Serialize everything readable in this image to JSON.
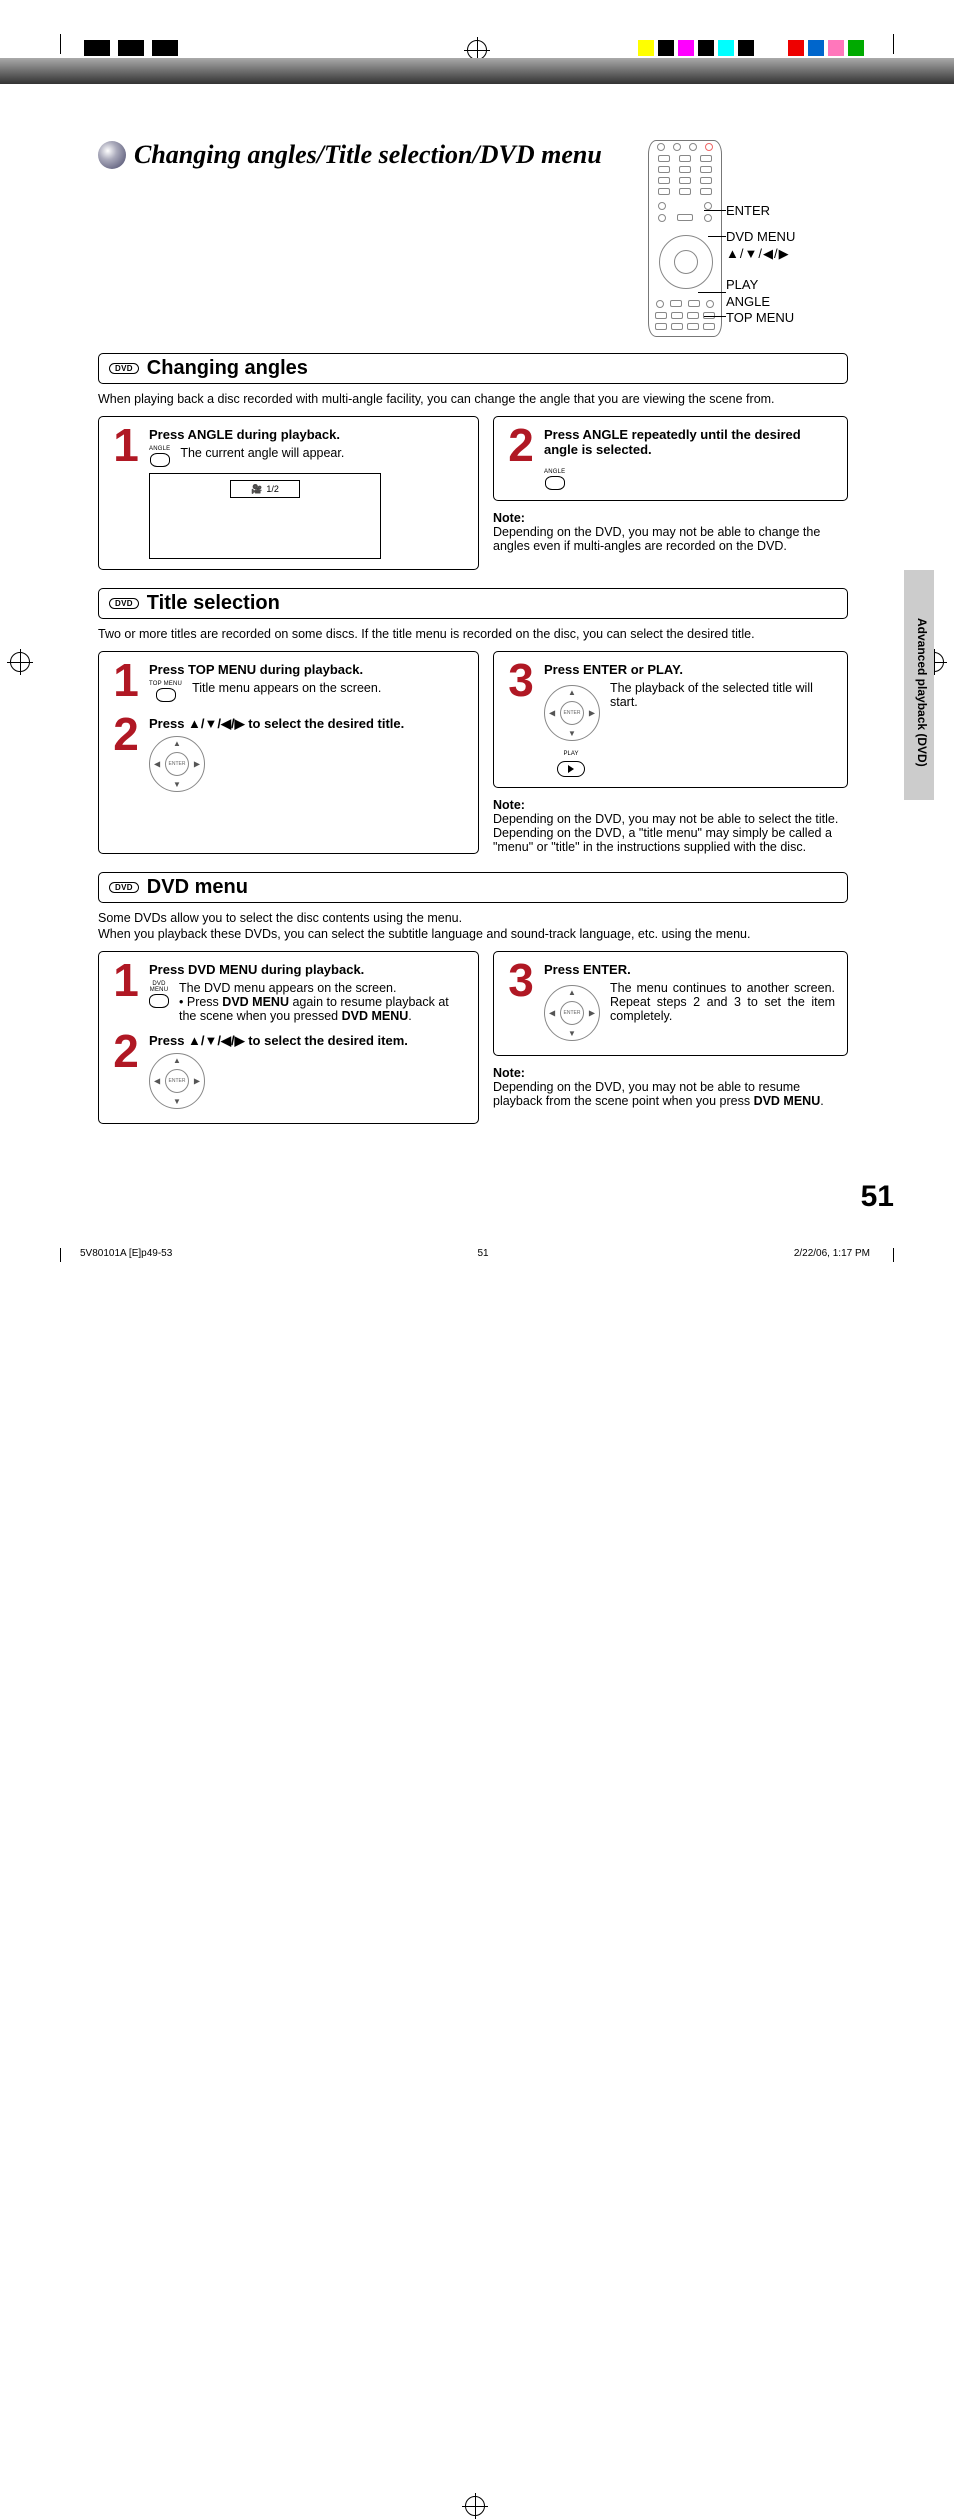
{
  "page_title": "Changing angles/Title selection/DVD menu",
  "remote_labels": {
    "enter": "ENTER",
    "dvdmenu": "DVD MENU",
    "arrows": "▲/▼/◀/▶",
    "play": "PLAY",
    "angle": "ANGLE",
    "topmenu": "TOP MENU"
  },
  "dvd_badge": "DVD",
  "sections": {
    "angles": {
      "title": "Changing angles",
      "intro": "When playing back a disc recorded with multi-angle facility, you can change the angle that you are viewing the scene from.",
      "step1": {
        "num": "1",
        "title": "Press ANGLE during playback.",
        "body": "The current angle will appear.",
        "btn": "ANGLE",
        "osd": "1/2"
      },
      "step2": {
        "num": "2",
        "title": "Press ANGLE repeatedly until the desired angle is selected.",
        "btn": "ANGLE"
      },
      "note_label": "Note:",
      "note": "Depending on the DVD, you may not be able to change the angles even if multi-angles are recorded on the DVD."
    },
    "title_sel": {
      "title": "Title selection",
      "intro": "Two or more titles are recorded on some discs. If the title menu is recorded on the disc, you can select the desired title.",
      "step1": {
        "num": "1",
        "title": "Press TOP MENU during playback.",
        "body": "Title menu appears on the screen.",
        "btn": "TOP MENU"
      },
      "step2": {
        "num": "2",
        "title": "Press ▲/▼/◀/▶ to select the desired title."
      },
      "step3": {
        "num": "3",
        "title": "Press ENTER or PLAY.",
        "body": "The playback of the selected title will start.",
        "play_label": "PLAY"
      },
      "note_label": "Note:",
      "note": "Depending on the DVD, you may not be able to select the title. Depending on the DVD, a \"title menu\" may simply be called a \"menu\" or \"title\" in the instructions supplied with the disc."
    },
    "dvd_menu": {
      "title": "DVD menu",
      "intro1": "Some DVDs allow you to select the disc contents using the menu.",
      "intro2": "When you playback these DVDs, you can select the subtitle language and sound-track language, etc. using the menu.",
      "step1": {
        "num": "1",
        "title": "Press DVD MENU during playback.",
        "body_a": "The DVD menu appears on the screen.",
        "body_b_pre": "Press ",
        "body_b_bold": "DVD MENU",
        "body_b_mid": " again to resume playback at the scene when you pressed ",
        "body_b_bold2": "DVD MENU",
        "body_b_end": ".",
        "btn": "DVD MENU"
      },
      "step2": {
        "num": "2",
        "title": "Press ▲/▼/◀/▶ to select the desired item."
      },
      "step3": {
        "num": "3",
        "title": "Press ENTER.",
        "body": "The menu continues to another screen. Repeat steps 2 and 3 to set the item completely."
      },
      "note_label": "Note:",
      "note_a": "Depending on the DVD, you may not be able to resume playback from the scene point when you press ",
      "note_b": "DVD MENU",
      "note_c": "."
    }
  },
  "side_tab": "Advanced playback (DVD)",
  "camera_glyph": "🎥",
  "page_number": "51",
  "footer": {
    "doc": "5V80101A [E]p49-53",
    "page": "51",
    "date": "2/22/06, 1:17 PM"
  }
}
